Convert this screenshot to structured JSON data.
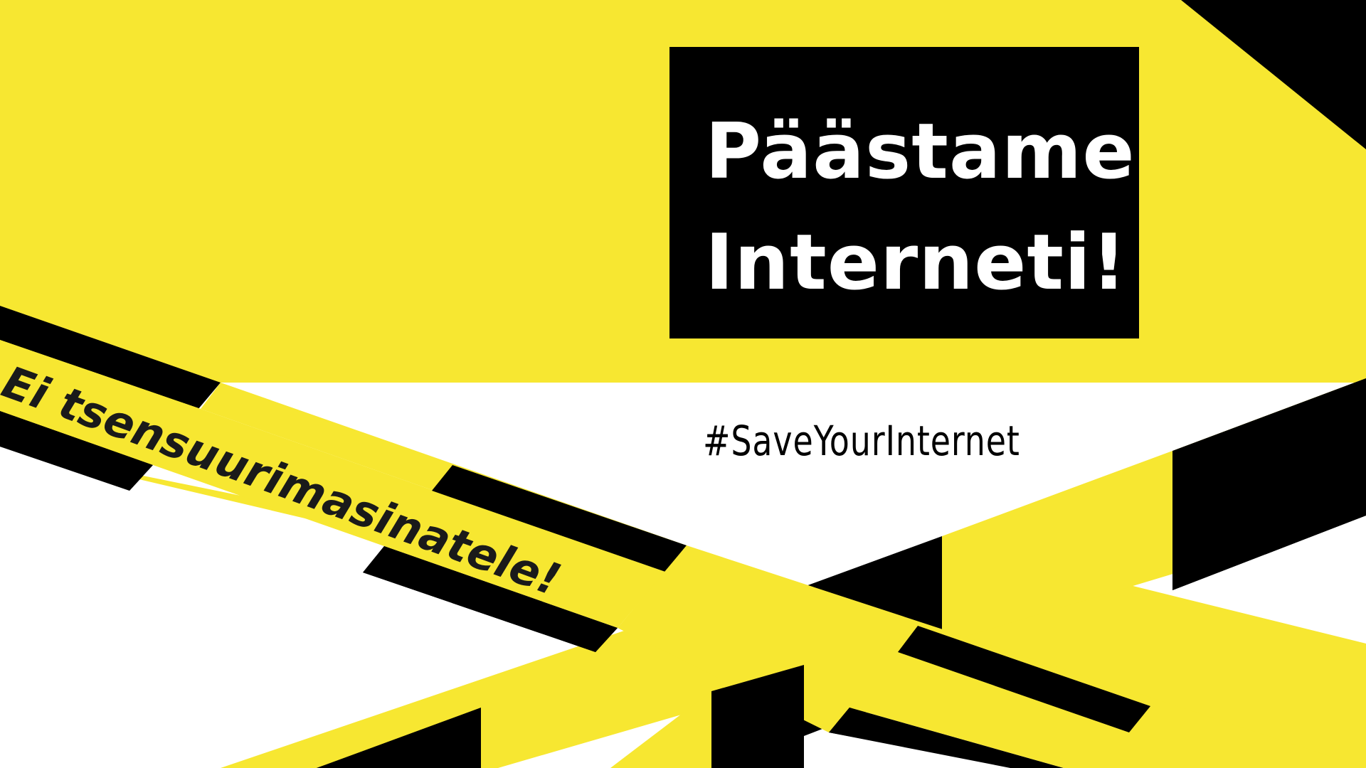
{
  "headline": {
    "line1": "Päästame",
    "line2": "Interneti!"
  },
  "hashtag": "#SaveYourInternet",
  "slogan": "Ei tsensuurimasinatele!",
  "colors": {
    "tape_yellow": "#f7e731",
    "tape_black": "#000000",
    "headline_box": "#000000",
    "headline_text": "#ffffff",
    "background": "#ffffff"
  }
}
